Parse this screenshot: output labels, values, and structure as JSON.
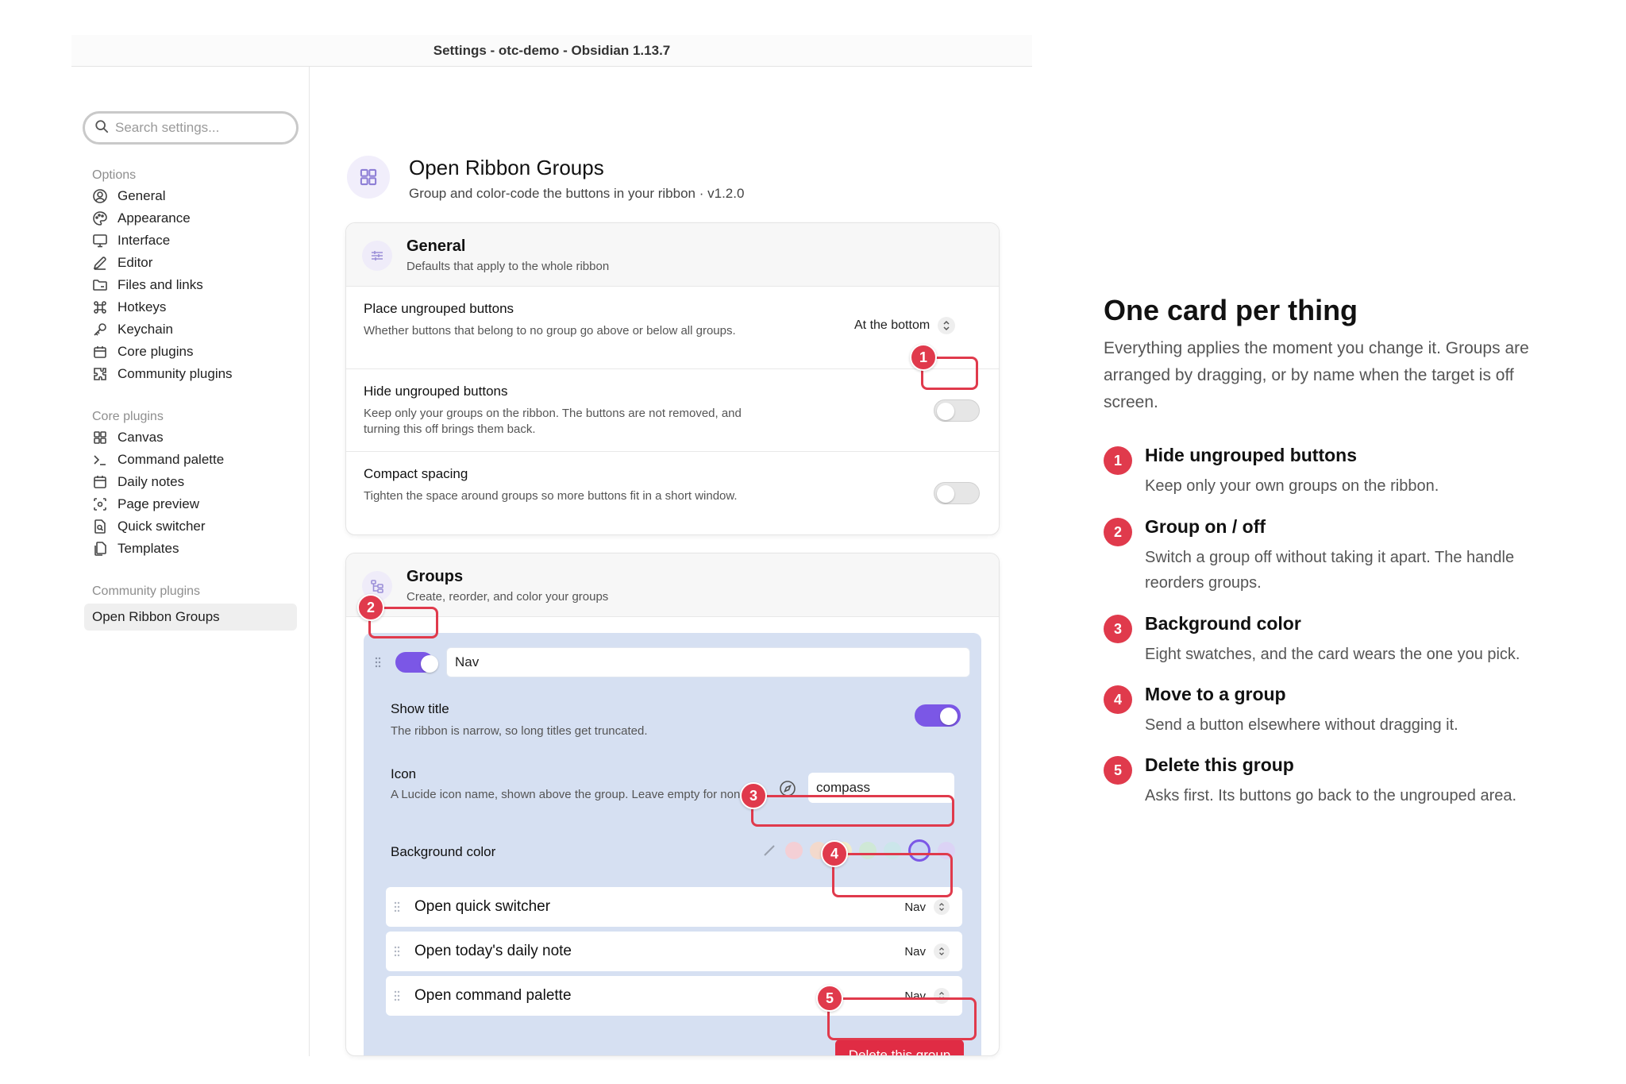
{
  "window": {
    "title": "Settings - otc-demo - Obsidian 1.13.7"
  },
  "sidebar": {
    "search_placeholder": "Search settings...",
    "sections": {
      "options": {
        "title": "Options",
        "items": [
          "General",
          "Appearance",
          "Interface",
          "Editor",
          "Files and links",
          "Hotkeys",
          "Keychain",
          "Core plugins",
          "Community plugins"
        ]
      },
      "core": {
        "title": "Core plugins",
        "items": [
          "Canvas",
          "Command palette",
          "Daily notes",
          "Page preview",
          "Quick switcher",
          "Templates"
        ]
      },
      "community": {
        "title": "Community plugins",
        "items": [
          "Open Ribbon Groups"
        ]
      }
    }
  },
  "plugin": {
    "title": "Open Ribbon Groups",
    "subtitle": "Group and color-code the buttons in your ribbon · v1.2.0",
    "icon": "grid-icon"
  },
  "general_card": {
    "title": "General",
    "subtitle": "Defaults that apply to the whole ribbon",
    "rows": [
      {
        "name": "Place ungrouped buttons",
        "desc": "Whether buttons that belong to no group go above or below all groups.",
        "control": "select",
        "value": "At the bottom"
      },
      {
        "name": "Hide ungrouped buttons",
        "desc": "Keep only your groups on the ribbon. The buttons are not removed, and turning this off brings them back.",
        "control": "toggle",
        "on": false
      },
      {
        "name": "Compact spacing",
        "desc": "Tighten the space around groups so more buttons fit in a short window.",
        "control": "toggle",
        "on": false
      }
    ]
  },
  "groups_card": {
    "title": "Groups",
    "subtitle": "Create, reorder, and color your groups",
    "group": {
      "enabled": true,
      "name": "Nav",
      "panel_color": "#d6e0f2",
      "show_title": {
        "name": "Show title",
        "desc": "The ribbon is narrow, so long titles get truncated.",
        "on": true
      },
      "icon": {
        "name": "Icon",
        "desc": "A Lucide icon name, shown above the group. Leave empty for none.",
        "value": "compass"
      },
      "background": {
        "name": "Background color",
        "swatches": [
          "#f4cfd5",
          "#f3d9cc",
          "#f1eccb",
          "#cfe8d6",
          "#cbe6ea",
          "#c9d6f4",
          "#dcd3f5"
        ],
        "selected_index": 5
      },
      "buttons": [
        {
          "name": "Open quick switcher",
          "group": "Nav"
        },
        {
          "name": "Open today's daily note",
          "group": "Nav"
        },
        {
          "name": "Open command palette",
          "group": "Nav"
        }
      ],
      "delete_label": "Delete this group"
    }
  },
  "callouts": [
    "1",
    "2",
    "3",
    "4",
    "5"
  ],
  "legend": {
    "title": "One card per thing",
    "intro": "Everything applies the moment you change it. Groups are arranged by dragging, or by name when the target is off screen.",
    "items": [
      {
        "n": "1",
        "title": "Hide ungrouped buttons",
        "desc": "Keep only your own groups on the ribbon."
      },
      {
        "n": "2",
        "title": "Group on / off",
        "desc": "Switch a group off without taking it apart. The handle reorders groups."
      },
      {
        "n": "3",
        "title": "Background color",
        "desc": "Eight swatches, and the card wears the one you pick."
      },
      {
        "n": "4",
        "title": "Move to a group",
        "desc": "Send a button elsewhere without dragging it."
      },
      {
        "n": "5",
        "title": "Delete this group",
        "desc": "Asks first. Its buttons go back to the ungrouped area."
      }
    ]
  },
  "colors": {
    "accent": "#7b57e6",
    "callout": "#e03a4c",
    "delete": "#e02c44"
  }
}
